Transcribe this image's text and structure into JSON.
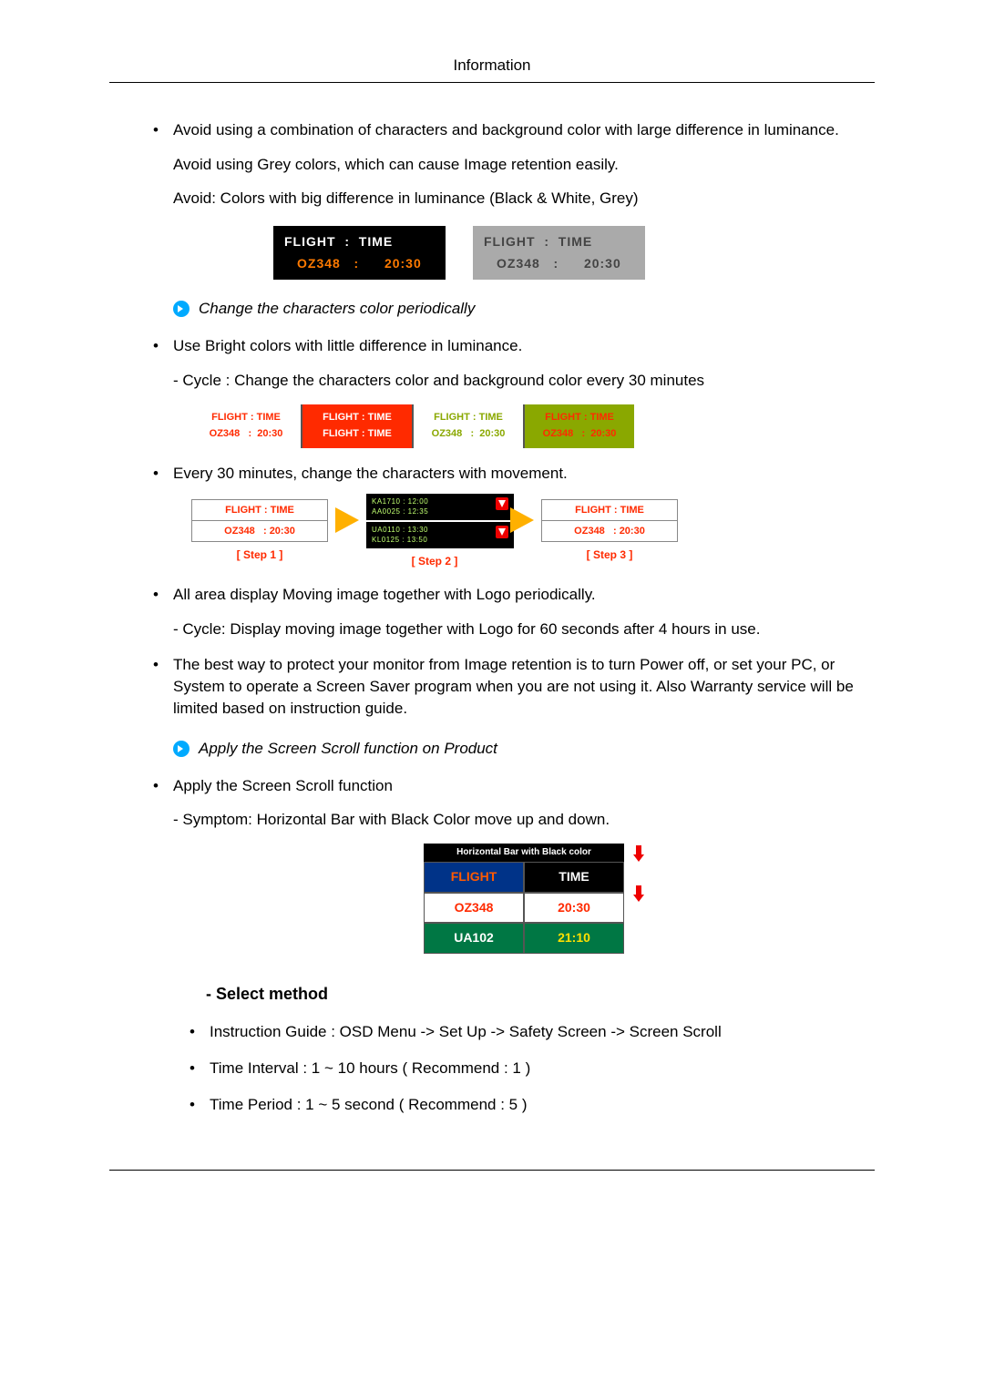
{
  "header": {
    "title": "Information"
  },
  "p1": "Avoid using a combination of characters and background color with large difference in luminance.",
  "p2": "Avoid using Grey colors, which can cause Image retention easily.",
  "p3": "Avoid: Colors with big difference in luminance (Black & White, Grey)",
  "demo1": {
    "header": "FLIGHT  :  TIME",
    "flight": "OZ348",
    "time": "20:30"
  },
  "sec1_label": "Change the characters color periodically",
  "b1": "Use Bright colors with little difference in luminance.",
  "b1_sub": "Cycle : Change the characters color and background color every 30 minutes",
  "cycle_header": "FLIGHT : TIME",
  "cycle_val": "OZ348   :  20:30",
  "b2": "Every 30 minutes, change the characters with movement.",
  "step_labels": {
    "s1": "[ Step 1 ]",
    "s2": "[ Step 2 ]",
    "s3": "[ Step 3 ]"
  },
  "step_box": {
    "l1": "FLIGHT : TIME",
    "l2": "OZ348   : 20:30"
  },
  "mid": {
    "a1": "KA1710 : 12:00",
    "a2": "AA0025 : 12:35",
    "b1": "UA0110 : 13:30",
    "b2": "KL0125 : 13:50"
  },
  "b3": "All area display Moving image together with Logo periodically.",
  "b3_sub": "Cycle: Display moving image together with Logo for 60 seconds after 4 hours in use.",
  "b4": "The best way to protect your monitor from Image retention is to turn Power off, or set your PC, or System to operate a Screen Saver program when you are not using it. Also Warranty service will be limited based on instruction guide.",
  "sec2_label": "Apply the Screen Scroll function on Product",
  "b5": "Apply the Screen Scroll function",
  "b5_sub": "Symptom: Horizontal Bar with Black Color move up and down.",
  "scroll": {
    "header": "Horizontal Bar with Black color",
    "r1a": "FLIGHT",
    "r1b": "TIME",
    "r2a": "OZ348",
    "r2b": "20:30",
    "r3a": "UA102",
    "r3b": "21:10"
  },
  "select_method_title": "- Select method",
  "m1": "Instruction Guide : OSD Menu -> Set Up -> Safety Screen -> Screen Scroll",
  "m2": "Time Interval : 1 ~ 10 hours ( Recommend : 1 )",
  "m3": "Time Period : 1 ~ 5 second ( Recommend : 5 )"
}
